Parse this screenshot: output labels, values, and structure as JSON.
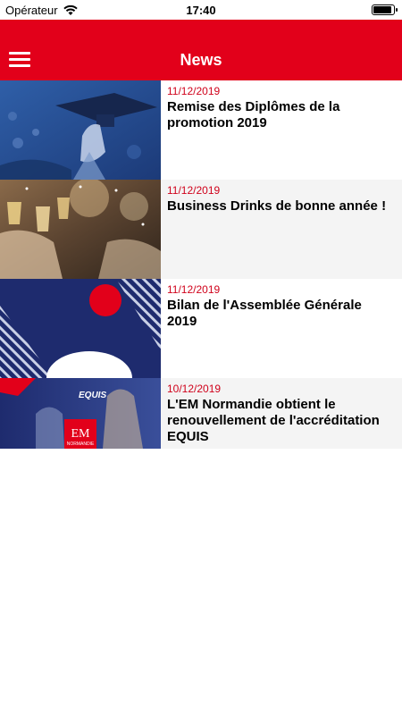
{
  "status_bar": {
    "carrier": "Opérateur",
    "time": "17:40"
  },
  "header": {
    "title": "News",
    "menu_icon": "hamburger-menu-icon"
  },
  "news": [
    {
      "date": "11/12/2019",
      "title": "Remise des Diplômes de la promotion 2019"
    },
    {
      "date": "11/12/2019",
      "title": "Business Drinks de bonne année !"
    },
    {
      "date": "11/12/2019",
      "title": "Bilan de l'Assemblée Générale 2019"
    },
    {
      "date": "10/12/2019",
      "title": "L'EM Normandie obtient le renouvellement de l'accréditation EQUIS"
    }
  ],
  "logos": {
    "equis": "EQUIS",
    "em": "EM",
    "normandie": "NORMANDIE"
  },
  "colors": {
    "brand": "#e2001a",
    "date": "#d0021b"
  }
}
